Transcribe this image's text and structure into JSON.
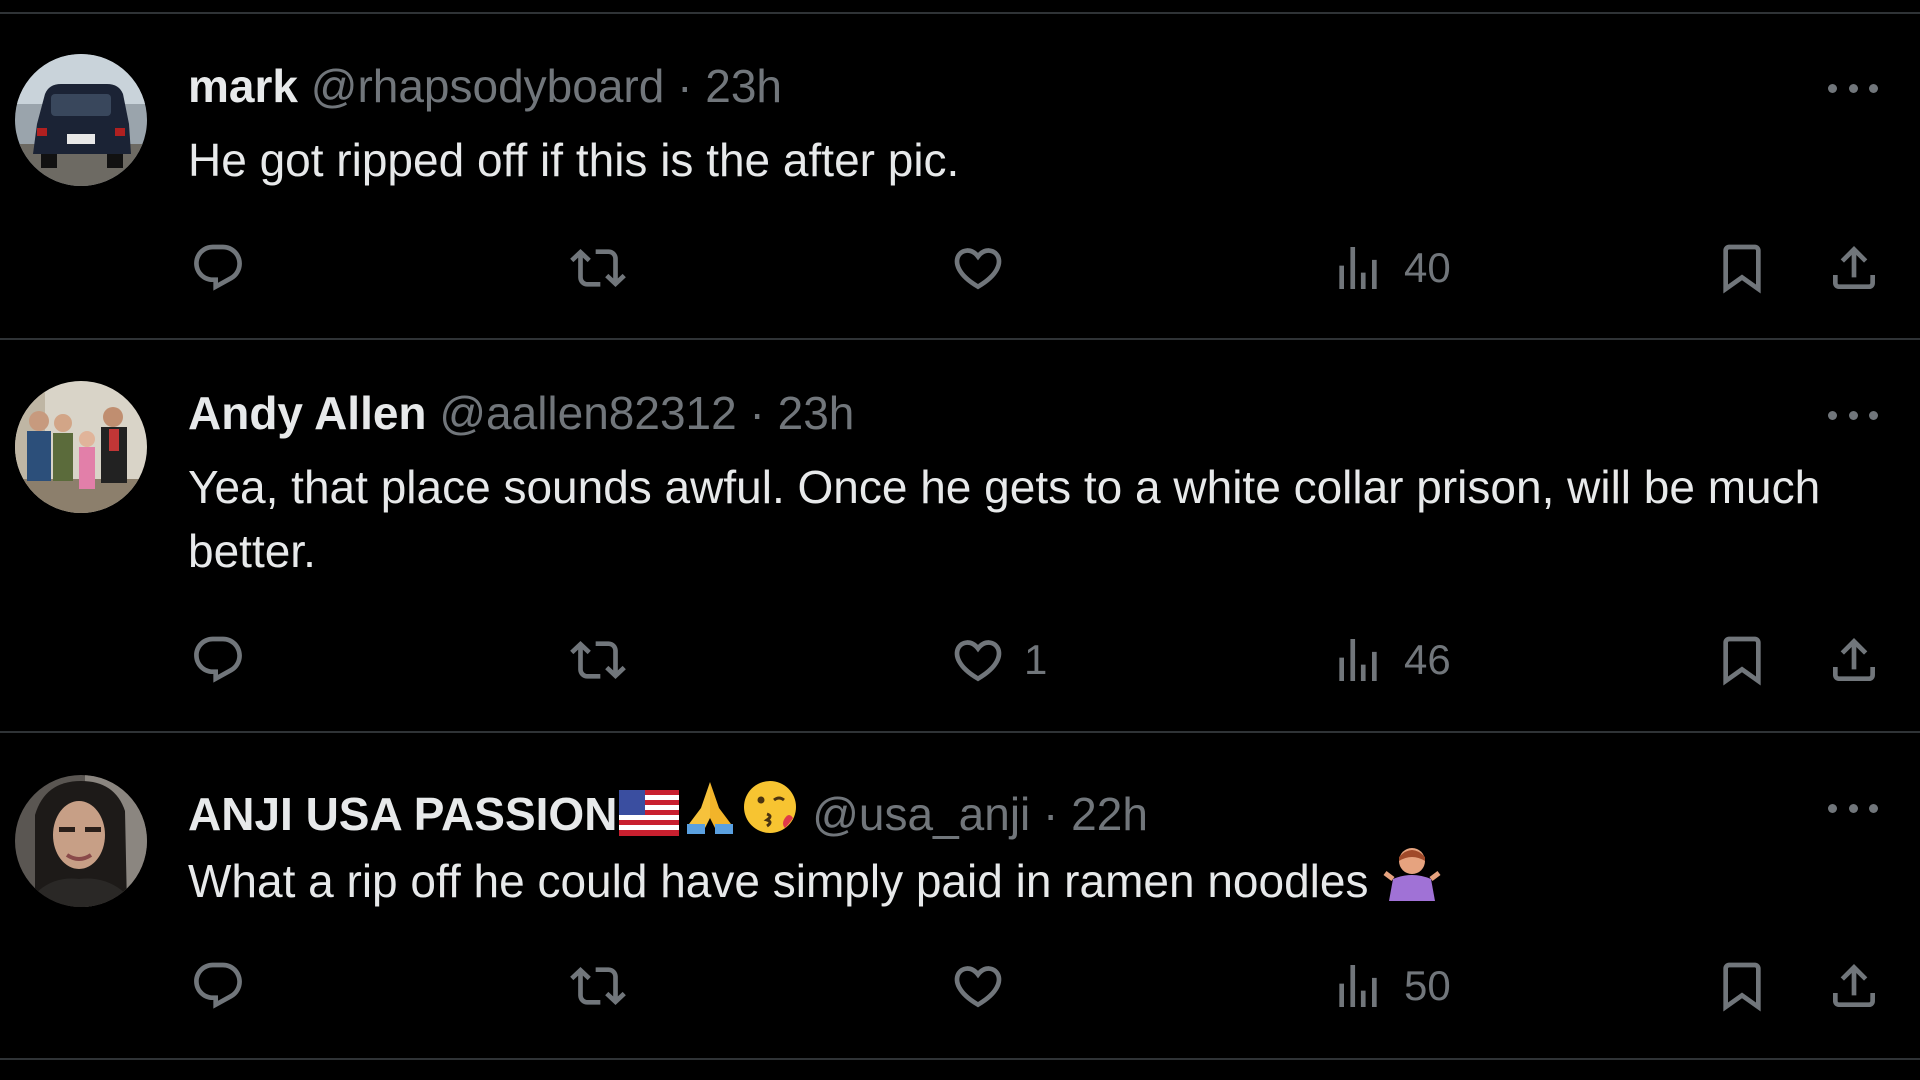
{
  "tweets": [
    {
      "name": "mark",
      "name_emojis": [],
      "handle": "@rhapsodyboard",
      "separator": "·",
      "time": "23h",
      "text": "He got ripped off if this is the after pic.",
      "trailing_emoji": "",
      "reply_count": "",
      "retweet_count": "",
      "like_count": "",
      "view_count": "40",
      "avatar_icon": "avatar-minivan"
    },
    {
      "name": "Andy Allen",
      "name_emojis": [],
      "handle": "@aallen82312",
      "separator": "·",
      "time": "23h",
      "text": "Yea, that place sounds awful. Once he gets to a white collar prison, will be much better.",
      "trailing_emoji": "",
      "reply_count": "",
      "retweet_count": "",
      "like_count": "1",
      "view_count": "46",
      "avatar_icon": "avatar-family"
    },
    {
      "name": "ANJI USA PASSION",
      "name_emojis": [
        "us-flag-emoji",
        "folded-hands-emoji",
        "kissing-face-emoji"
      ],
      "handle": "@usa_anji",
      "separator": "·",
      "time": "22h",
      "text": "What a rip off he could have simply paid in ramen noodles",
      "trailing_emoji": "person-shrugging-emoji",
      "reply_count": "",
      "retweet_count": "",
      "like_count": "",
      "view_count": "50",
      "avatar_icon": "avatar-woman"
    }
  ],
  "colors": {
    "background": "#000000",
    "text_primary": "#e7e9ea",
    "text_secondary": "#71767b",
    "divider": "#2f3336"
  }
}
